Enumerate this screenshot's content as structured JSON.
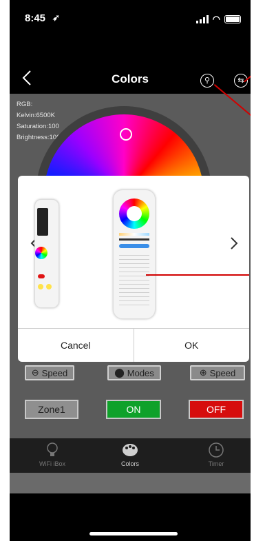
{
  "status_bar": {
    "time": "8:45"
  },
  "nav": {
    "title": "Colors",
    "back_icon": "chevron-left-icon",
    "right_icons": [
      "link-icon",
      "swap-icon"
    ]
  },
  "info": {
    "rgb": "RGB:",
    "kelvin": "Kelvin:6500K",
    "saturation": "Saturation:100",
    "brightness": "Brightness:100"
  },
  "controls": {
    "speed_minus": "Speed",
    "modes": "Modes",
    "speed_plus": "Speed"
  },
  "zone_row": {
    "zone": "Zone1",
    "on": "ON",
    "off": "OFF"
  },
  "colors": {
    "on_bg": "#0fa12a",
    "off_bg": "#d60d0d",
    "accent_line": "#d10000"
  },
  "tabs": [
    {
      "label": "WiFi iBox",
      "icon": "bulb-icon"
    },
    {
      "label": "Colors",
      "icon": "palette-icon"
    },
    {
      "label": "Timer",
      "icon": "clock-icon"
    }
  ],
  "dialog": {
    "cancel": "Cancel",
    "ok": "OK",
    "prev_icon": "chevron-left-icon",
    "next_icon": "chevron-right-icon"
  }
}
